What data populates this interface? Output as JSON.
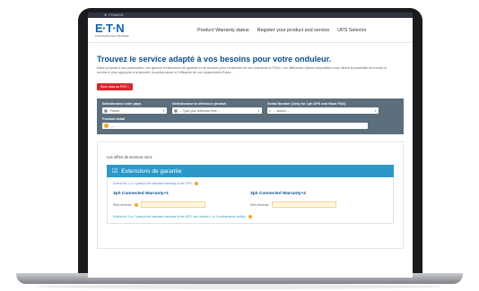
{
  "topbar": {
    "globe_icon": "globe-icon",
    "region": "FRANCE"
  },
  "nav": {
    "logo_text": "E·T·N",
    "logo_tagline": "Powering Business Worldwide",
    "links": [
      "Product Warranty status",
      "Register your product and service",
      "UPS Selector"
    ]
  },
  "main": {
    "title": "Trouvez le service adapté à vos besoins pour votre onduleur.",
    "intro": "Eaton propose à ses partenaires, une gamme d'extensions de garantie et de services pour l'ensemble de ses onduleurs et PDUs. Les différentes options disponibles vous offrent la possibilité de trouver le service le plus approprié à la sécurité, la performance et l'efficacité de vos équipements Eaton.",
    "pdf_button": "Save data as PDF ⤓"
  },
  "filter": {
    "country_label": "Sélectionnez votre pays",
    "country_value": "France",
    "product_ref_label": "Sélectionnez la référence produit",
    "product_ref_placeholder": "-- Type your reference here --",
    "serial_label": "Serial Number (Only for 1ph UPS and Rack PDU)",
    "serial_placeholder": "-- search --",
    "detail_label": "Product detail",
    "detail_value": "—"
  },
  "offers": {
    "title": "Les offres de services sont:",
    "extension_header": "Extensions de garantie",
    "note1": "Extend for 1 or 2 year(s) the standard warranty of the UPS",
    "warranty_left_title": "3ph Connected Warranty+1",
    "warranty_right_title": "3ph Connected Warranty+2",
    "web_ref_label": "Web reference",
    "note2": "Extend for 1 or 2 year(s) the standard warranty of the UPS, and include 1 or 2 maintenance visit(s)"
  },
  "colors": {
    "brand_blue": "#0a64b4",
    "accent_teal": "#2c98c9",
    "filter_bg": "#5c6e7c",
    "pdf_red": "#d7262e"
  }
}
